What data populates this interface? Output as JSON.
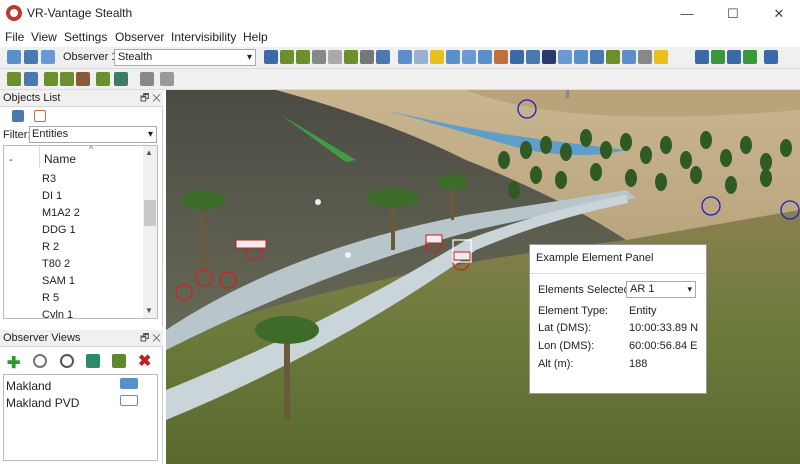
{
  "window": {
    "title": "VR-Vantage Stealth",
    "minimize": "—",
    "maximize": "☐",
    "close": "✕"
  },
  "menu": [
    "File",
    "View",
    "Settings",
    "Observer",
    "Intervisibility",
    "Help"
  ],
  "toolbar": {
    "observer_label": "Observer 1",
    "observer_value": "Stealth"
  },
  "objects_panel": {
    "title": "Objects List",
    "controls": "🗗 ✕",
    "filter_label": "Filter:",
    "filter_value": "Entities",
    "column_dash": "-",
    "column_name": "Name",
    "sort_arrow": "^",
    "items": [
      "R3",
      "DI 1",
      "M1A2 2",
      "DDG 1",
      "R 2",
      "T80 2",
      "SAM 1",
      "R 5",
      "Cyln 1"
    ]
  },
  "views_panel": {
    "title": "Observer Views",
    "controls": "🗗 ✕",
    "items": [
      "Makland",
      "Makland PVD"
    ]
  },
  "element_panel": {
    "title": "Example Element Panel",
    "selected_label": "Elements Selected:",
    "selected_value": "AR 1",
    "type_label": "Element Type:",
    "type_value": "Entity",
    "lat_label": "Lat (DMS):",
    "lat_value": "10:00:33.89 N",
    "lon_label": "Lon (DMS):",
    "lon_value": "60:00:56.84 E",
    "alt_label": "Alt (m):",
    "alt_value": "188"
  },
  "colors": {
    "accent": "#c0392b",
    "terrain": "#8a7a5a",
    "road": "#b8c6cc",
    "marker_red": "#d22020",
    "marker_blue": "#2020c0"
  }
}
